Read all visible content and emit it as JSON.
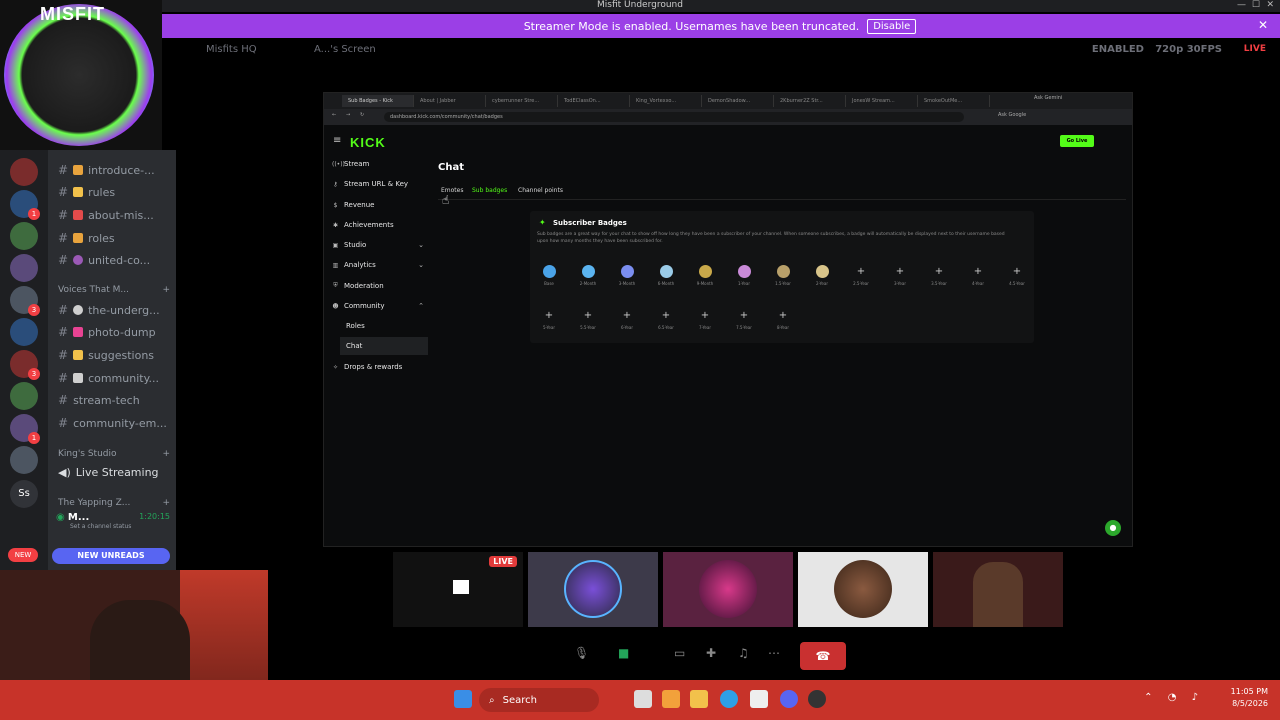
{
  "window": {
    "title": "Misfit Underground"
  },
  "banner": {
    "text": "Streamer Mode is enabled. Usernames have been truncated.",
    "disable_label": "Disable"
  },
  "stage_top": {
    "server": "Misfits HQ",
    "screen": "A...'s Screen",
    "enabled": "ENABLED",
    "quality": "720p 30FPS",
    "live": "LIVE"
  },
  "misfit_logo_text": "MISFIT",
  "channels": [
    {
      "name": "introduce-...",
      "emoji_color": "#e8a33d"
    },
    {
      "name": "rules",
      "emoji_color": "#f2c14b"
    },
    {
      "name": "about-mis...",
      "emoji_color": "#e34b4b"
    },
    {
      "name": "roles",
      "emoji_color": "#e8a33d"
    },
    {
      "name": "united-co...",
      "emoji_color": "#9b59b6"
    }
  ],
  "category_voices": "Voices That M...",
  "channels2": [
    {
      "name": "the-underg...",
      "emoji_color": "#cfcfcf"
    },
    {
      "name": "photo-dump",
      "emoji_color": "#e84393"
    },
    {
      "name": "suggestions",
      "emoji_color": "#f2c14b"
    },
    {
      "name": "community...",
      "emoji_color": "#cfcfcf"
    },
    {
      "name": "stream-tech",
      "emoji_color": ""
    },
    {
      "name": "community-em...",
      "emoji_color": ""
    }
  ],
  "category_kings": "King's Studio",
  "live_streaming": "Live Streaming",
  "category_yapping": "The Yapping Z...",
  "voice_user": {
    "name": "M...",
    "time": "1:20:15",
    "status": "Set a channel status"
  },
  "new_unreads": "NEW UNREADS",
  "new_pill": "NEW",
  "server_initials": "Ss",
  "browser": {
    "tabs": [
      "Sub Badges - Kick",
      "About | Jabber",
      "cyberrunner Stre...",
      "TodEClassOn...",
      "King_Vortexxo...",
      "DemonShadow...",
      "2Kburner2Z Str...",
      "JonesW Stream...",
      "SmokeOutMe..."
    ],
    "url": "dashboard.kick.com/community/chat/badges",
    "ask_google": "Ask Google",
    "ask_gemini": "Ask Gemini"
  },
  "kick": {
    "logo": "KICK",
    "go_live": "Go Live",
    "nav": [
      {
        "label": "Stream",
        "icon": "stream-icon",
        "glyph": "((•))"
      },
      {
        "label": "Stream URL & Key",
        "icon": "key-icon",
        "glyph": "⚷"
      },
      {
        "label": "Revenue",
        "icon": "dollar-icon",
        "glyph": "$"
      },
      {
        "label": "Achievements",
        "icon": "star-icon",
        "glyph": "✱"
      },
      {
        "label": "Studio",
        "icon": "studio-icon",
        "glyph": "▣"
      },
      {
        "label": "Analytics",
        "icon": "chart-icon",
        "glyph": "▥"
      },
      {
        "label": "Moderation",
        "icon": "shield-icon",
        "glyph": "⛨"
      },
      {
        "label": "Community",
        "icon": "people-icon",
        "glyph": "☻"
      }
    ],
    "sub_nav": [
      "Roles",
      "Chat"
    ],
    "drops": "Drops & rewards",
    "page_title": "Chat",
    "tabs": [
      "Emotes",
      "Sub badges",
      "Channel points"
    ],
    "panel_title": "Subscriber Badges",
    "panel_desc": "Sub badges are a great way for your chat to show off how long they have been a subscriber of your channel. When someone subscribes, a badge will automatically be displayed next to their username based upon how many months they have been subscribed for.",
    "badges_row1": [
      {
        "label": "Base",
        "set": true,
        "color": "#4aa3e8"
      },
      {
        "label": "2-Month",
        "set": true,
        "color": "#5bb4f0"
      },
      {
        "label": "3-Month",
        "set": true,
        "color": "#7b8ef0"
      },
      {
        "label": "6-Month",
        "set": true,
        "color": "#9acbe8"
      },
      {
        "label": "9-Month",
        "set": true,
        "color": "#c9a94a"
      },
      {
        "label": "1-Year",
        "set": true,
        "color": "#c98ad8"
      },
      {
        "label": "1.5-Year",
        "set": true,
        "color": "#b8a06a"
      },
      {
        "label": "2-Year",
        "set": true,
        "color": "#d8c48a"
      },
      {
        "label": "2.5-Year",
        "set": false
      },
      {
        "label": "3-Year",
        "set": false
      },
      {
        "label": "3.5-Year",
        "set": false
      },
      {
        "label": "4-Year",
        "set": false
      },
      {
        "label": "4.5-Year",
        "set": false
      }
    ],
    "badges_row2": [
      {
        "label": "5-Year"
      },
      {
        "label": "5.5-Year"
      },
      {
        "label": "6-Year"
      },
      {
        "label": "6.5-Year"
      },
      {
        "label": "7-Year"
      },
      {
        "label": "7.5-Year"
      },
      {
        "label": "8-Year"
      }
    ]
  },
  "tiles": {
    "live_label": "LIVE"
  },
  "taskbar": {
    "search": "Search",
    "time": "11:05 PM",
    "date": "8/5/2026"
  }
}
